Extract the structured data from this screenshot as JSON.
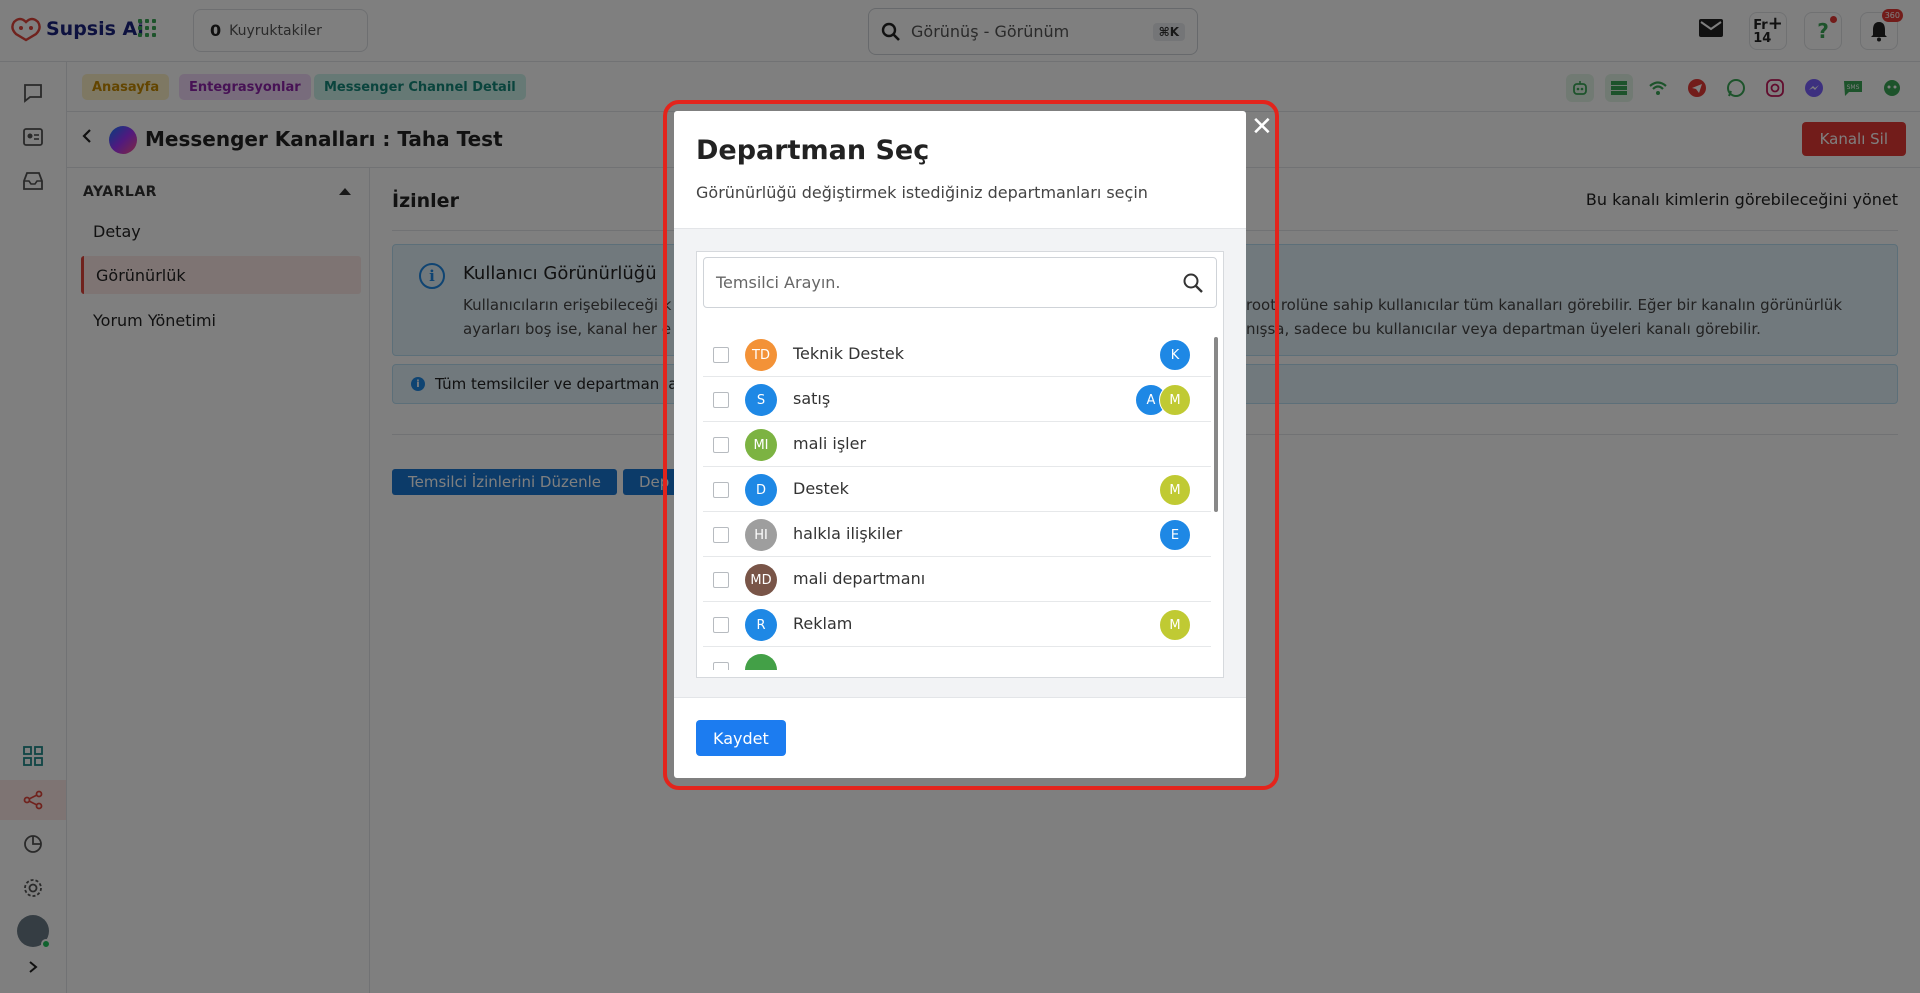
{
  "app": {
    "name": "Supsis Ai",
    "brand_color": "#e0453b"
  },
  "topbar": {
    "queue_count": "0",
    "queue_label": "Kuyruktakiler",
    "search_value": "Görünüş - Görünüm",
    "search_shortcut": "⌘K",
    "calendar_day": "Fr",
    "calendar_date": "14",
    "notification_count": "360"
  },
  "breadcrumbs": [
    "Anasayfa",
    "Entegrasyonlar",
    "Messenger Channel Detail"
  ],
  "page": {
    "title": "Messenger Kanalları : Taha Test",
    "delete_label": "Kanalı Sil"
  },
  "settings": {
    "header": "AYARLAR",
    "items": [
      {
        "label": "Detay"
      },
      {
        "label": "Görünürlük",
        "active": true
      },
      {
        "label": "Yorum Yönetimi"
      }
    ]
  },
  "main": {
    "title": "İzinler",
    "subtitle": "Bu kanalı kimlerin görebileceğini yönet",
    "info_title": "Kullanıcı Görünürlüğü",
    "info_text_left_1": "Kullanıcıların erişebileceği k",
    "info_text_right_1": "root rolüne sahip kullanıcılar tüm kanalları görebilir. Eğer bir kanalın görünürlük",
    "info_text_left_2": "ayarları boş ise, kanal her e",
    "info_text_right_2": "nışsa, sadece bu kullanıcılar veya departman üyeleri kanalı görebilir.",
    "info_line": "Tüm temsilciler ve departman la",
    "btn_reps": "Temsilci İzinlerini Düzenle",
    "btn_depts": "Dep"
  },
  "modal": {
    "title": "Departman Seç",
    "subtitle": "Görünürlüğü değiştirmek istediğiniz departmanları seçin",
    "search_placeholder": "Temsilci Arayın.",
    "save_label": "Kaydet",
    "departments": [
      {
        "initials": "TD",
        "name": "Teknik Destek",
        "color": "#f39237",
        "members": [
          {
            "initials": "K",
            "color": "#1e88e5"
          }
        ]
      },
      {
        "initials": "S",
        "name": "satış",
        "color": "#1e88e5",
        "members": [
          {
            "initials": "A",
            "color": "#1e88e5"
          },
          {
            "initials": "M",
            "color": "#c0ca33"
          }
        ]
      },
      {
        "initials": "MI",
        "name": "mali işler",
        "color": "#7cb342",
        "members": []
      },
      {
        "initials": "D",
        "name": "Destek",
        "color": "#1e88e5",
        "members": [
          {
            "initials": "M",
            "color": "#c0ca33"
          }
        ]
      },
      {
        "initials": "HI",
        "name": "halkla ilişkiler",
        "color": "#9e9e9e",
        "members": [
          {
            "initials": "E",
            "color": "#1e88e5"
          }
        ]
      },
      {
        "initials": "MD",
        "name": "mali departmanı",
        "color": "#795548",
        "members": []
      },
      {
        "initials": "R",
        "name": "Reklam",
        "color": "#1e88e5",
        "members": [
          {
            "initials": "M",
            "color": "#c0ca33"
          }
        ]
      },
      {
        "initials": "",
        "name": "",
        "color": "#43a047",
        "members": []
      }
    ]
  }
}
